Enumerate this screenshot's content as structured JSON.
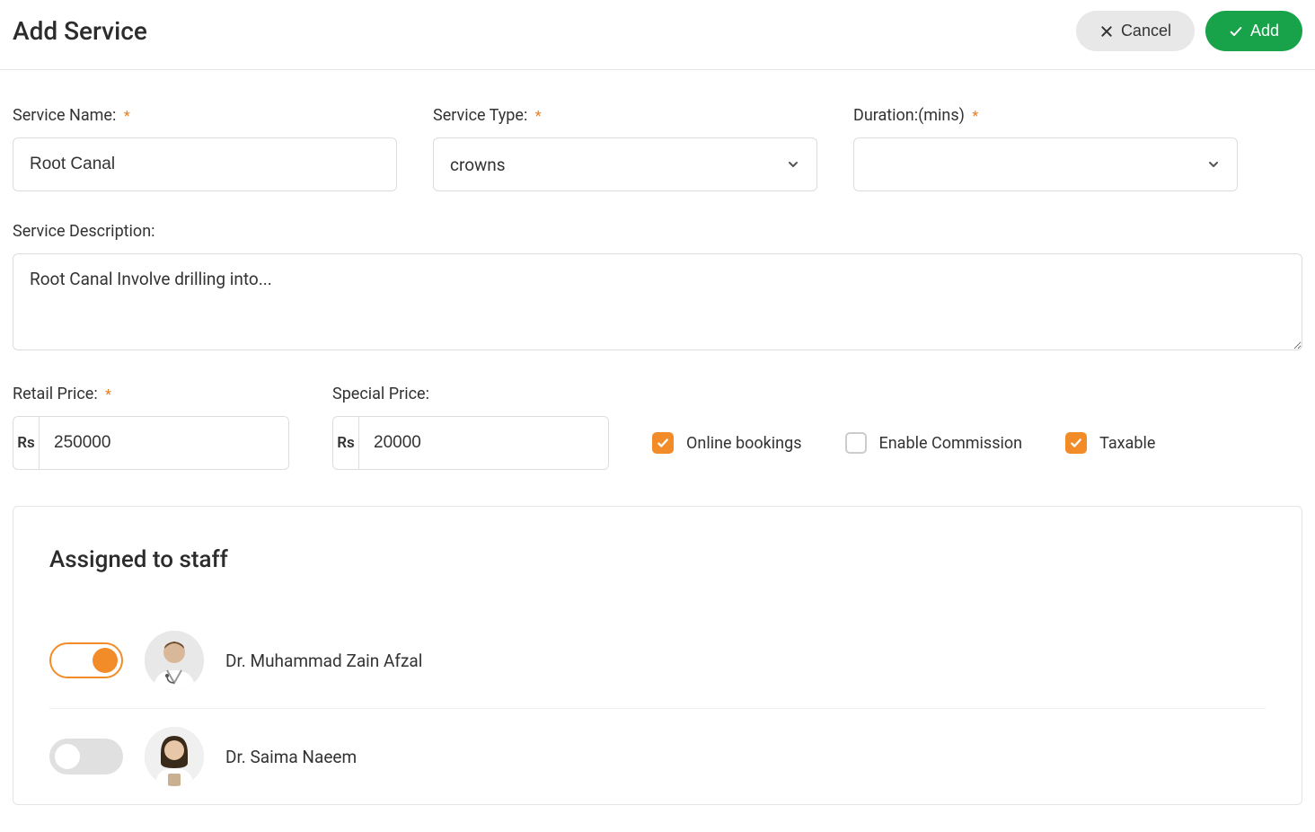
{
  "header": {
    "title": "Add Service",
    "cancel_label": "Cancel",
    "add_label": "Add"
  },
  "fields": {
    "service_name": {
      "label": "Service Name:",
      "required": true,
      "value": "Root Canal"
    },
    "service_type": {
      "label": "Service Type:",
      "required": true,
      "value": "crowns"
    },
    "duration": {
      "label": "Duration:(mins)",
      "required": true,
      "value": ""
    },
    "description": {
      "label": "Service Description:",
      "value": "Root Canal Involve drilling into..."
    },
    "retail_price": {
      "label": "Retail Price:",
      "required": true,
      "currency": "Rs",
      "value": "250000"
    },
    "special_price": {
      "label": "Special Price:",
      "required": false,
      "currency": "Rs",
      "value": "20000"
    }
  },
  "checks": {
    "online_bookings": {
      "label": "Online bookings",
      "checked": true
    },
    "enable_commission": {
      "label": "Enable Commission",
      "checked": false
    },
    "taxable": {
      "label": "Taxable",
      "checked": true
    }
  },
  "staff": {
    "heading": "Assigned to staff",
    "members": [
      {
        "name": "Dr. Muhammad Zain Afzal",
        "assigned": true,
        "avatar": "male-doctor"
      },
      {
        "name": "Dr. Saima Naeem",
        "assigned": false,
        "avatar": "female-doctor"
      }
    ]
  },
  "required_marker": "*"
}
